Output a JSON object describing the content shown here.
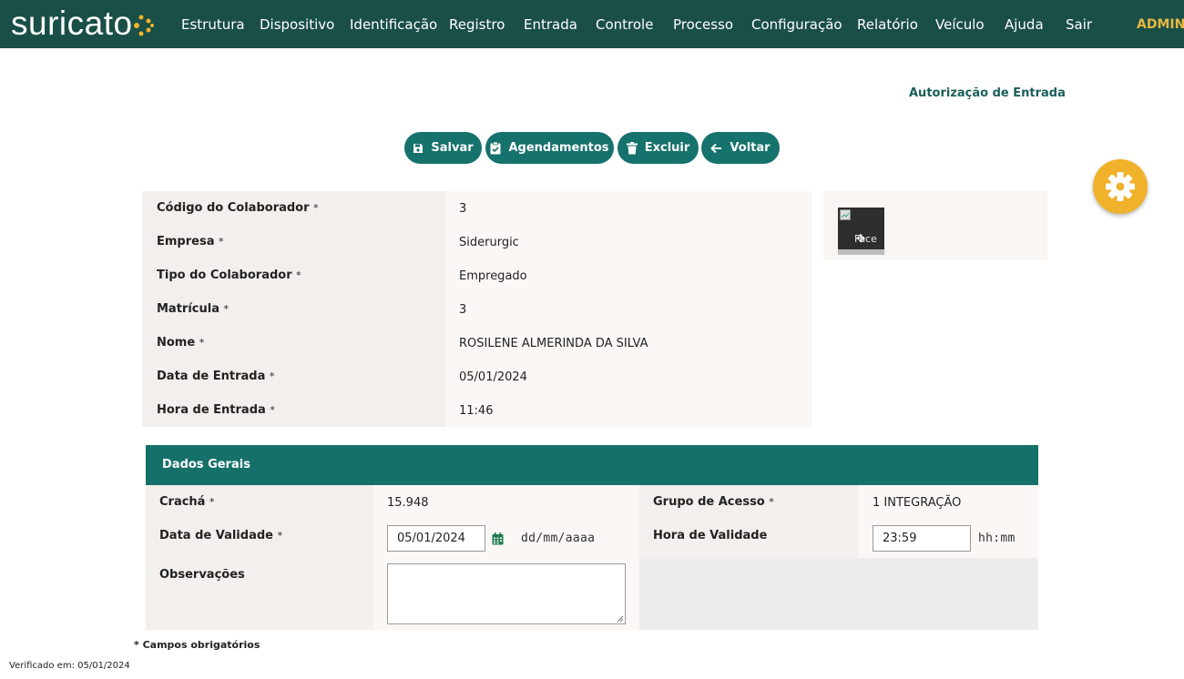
{
  "brand": {
    "logo_text": "suricato"
  },
  "nav": {
    "items": [
      "Estrutura",
      "Dispositivo",
      "Identificação",
      "Registro",
      "Entrada",
      "Controle",
      "Processo",
      "Configuração",
      "Relatório",
      "Veículo",
      "Ajuda",
      "Sair"
    ],
    "user": "ADMIN"
  },
  "page": {
    "title": "Autorização de Entrada"
  },
  "toolbar": {
    "save": "Salvar",
    "schedules": "Agendamentos",
    "delete": "Excluir",
    "back": "Voltar"
  },
  "collaborator": {
    "fields": [
      {
        "label": "Código do Colaborador",
        "value": "3"
      },
      {
        "label": "Empresa",
        "value": "Siderurgic"
      },
      {
        "label": "Tipo do Colaborador",
        "value": "Empregado"
      },
      {
        "label": "Matrícula",
        "value": "3"
      },
      {
        "label": "Nome",
        "value": "ROSILENE ALMERINDA DA SILVA"
      },
      {
        "label": "Data de Entrada",
        "value": "05/01/2024"
      },
      {
        "label": "Hora de Entrada",
        "value": "11:46"
      }
    ],
    "required_mark": "*",
    "photo_alt": "Face"
  },
  "general": {
    "title": "Dados Gerais",
    "badge_label": "Crachá",
    "badge_value": "15.948",
    "validity_date_label": "Data de Validade",
    "validity_date_value": "05/01/2024",
    "validity_date_hint": "dd/mm/aaaa",
    "notes_label": "Observações",
    "notes_value": "",
    "access_group_label": "Grupo de Acesso",
    "access_group_value": "1 INTEGRAÇÃO",
    "validity_time_label": "Hora de Validade",
    "validity_time_value": "23:59",
    "validity_time_hint": "hh:mm"
  },
  "footer": {
    "required_note": "* Campos obrigatórios",
    "verified": "Verificado em: 05/01/2024"
  },
  "colors": {
    "header_bg": "#1a4f48",
    "accent": "#16726c",
    "admin": "#e8b840",
    "fab": "#f0b22a"
  }
}
